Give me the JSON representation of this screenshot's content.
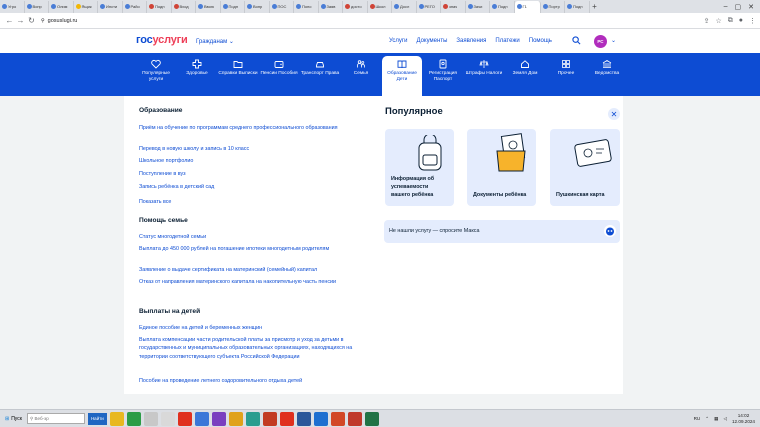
{
  "browser": {
    "tabs": [
      {
        "label": "Угро",
        "color": "#4a7dd6"
      },
      {
        "label": "Вопр",
        "color": "#4a7dd6"
      },
      {
        "label": "Олим",
        "color": "#4a7dd6"
      },
      {
        "label": "Ящик",
        "color": "#f2b705"
      },
      {
        "label": "Инсти",
        "color": "#4a7dd6"
      },
      {
        "label": "Райо",
        "color": "#4a7dd6"
      },
      {
        "label": "Подп",
        "color": "#d04437"
      },
      {
        "label": "Вход",
        "color": "#d04437"
      },
      {
        "label": "Ввою",
        "color": "#4a7dd6"
      },
      {
        "label": "Подп",
        "color": "#4a7dd6"
      },
      {
        "label": "Вопр",
        "color": "#4a7dd6"
      },
      {
        "label": "ПОС",
        "color": "#4a7dd6"
      },
      {
        "label": "Попо",
        "color": "#4a7dd6"
      },
      {
        "label": "Заяв",
        "color": "#4a7dd6"
      },
      {
        "label": "досто",
        "color": "#d04437"
      },
      {
        "label": "Школ",
        "color": "#d04437"
      },
      {
        "label": "Досл",
        "color": "#4a7dd6"
      },
      {
        "label": "РЕГО",
        "color": "#4a7dd6"
      },
      {
        "label": "знач",
        "color": "#d04437"
      },
      {
        "label": "Зачи",
        "color": "#4a7dd6"
      },
      {
        "label": "Подп",
        "color": "#4a7dd6"
      },
      {
        "label": "Г1",
        "color": "#4a7dd6",
        "active": true
      },
      {
        "label": "Портр",
        "color": "#4a7dd6"
      },
      {
        "label": "Подп",
        "color": "#4a7dd6"
      }
    ],
    "new_tab": "+",
    "url": "gosuslugi.ru"
  },
  "header": {
    "logo_part1": "гос",
    "logo_part2": "услуги",
    "audience": "Гражданам",
    "nav": [
      "Услуги",
      "Документы",
      "Заявления",
      "Платежи",
      "Помощь"
    ],
    "avatar_initials": "РС"
  },
  "categories": [
    {
      "label": "Популярные услуги",
      "icon": "heart-icon"
    },
    {
      "label": "Здоровье",
      "icon": "medical-cross-icon"
    },
    {
      "label": "Справки Выписки",
      "icon": "folder-icon"
    },
    {
      "label": "Пенсии Пособия",
      "icon": "wallet-icon"
    },
    {
      "label": "Транспорт Права",
      "icon": "car-icon"
    },
    {
      "label": "Семья",
      "icon": "family-icon"
    },
    {
      "label": "Образование Дети",
      "icon": "book-icon",
      "active": true
    },
    {
      "label": "Регистрация Паспорт",
      "icon": "passport-icon"
    },
    {
      "label": "Штрафы Налоги",
      "icon": "scales-icon"
    },
    {
      "label": "Земля Дом",
      "icon": "house-icon"
    },
    {
      "label": "Прочее",
      "icon": "grid-icon"
    },
    {
      "label": "Ведомства",
      "icon": "building-icon"
    }
  ],
  "sections": {
    "education": {
      "title": "Образование",
      "links": [
        "Приём на обучение по программам среднего профессионального образования",
        "Перевод в новую школу и запись в 10 класс",
        "Школьное портфолио",
        "Поступление в вуз",
        "Запись ребёнка в детский сад"
      ],
      "more": "Показать все"
    },
    "family_help": {
      "title": "Помощь семье",
      "links": [
        "Статус многодетной семьи",
        "Выплата до 450 000 рублей на погашение ипотеки многодетным родителям",
        "Заявление о выдаче сертификата на материнский (семейный) капитал",
        "Отказ от направления материнского капитала на накопительную часть пенсии"
      ]
    },
    "child_payments": {
      "title": "Выплаты на детей",
      "links": [
        "Единое пособие на детей и беременных женщин",
        "Выплата компенсации части родительской платы за присмотр и уход за детьми в государственных и муниципальных образовательных организациях, находящихся на территории соответствующего субъекта Российской Федерации",
        "Пособие на проведение летнего оздоровительного отдыха детей"
      ]
    }
  },
  "popular": {
    "title": "Популярное",
    "cards": [
      {
        "label": "Информация об успеваемости вашего ребёнка",
        "icon": "backpack-icon"
      },
      {
        "label": "Документы ребёнка",
        "icon": "child-documents-icon"
      },
      {
        "label": "Пушкинская карта",
        "icon": "pushkin-card-icon"
      }
    ],
    "ask": "Не нашли услугу — спросите Макса"
  },
  "taskbar": {
    "start": "Пуск",
    "search_placeholder": "Веб-эр",
    "active_button": "Найти",
    "lang": "RU",
    "time": "14:02",
    "date": "12.09.2024"
  }
}
